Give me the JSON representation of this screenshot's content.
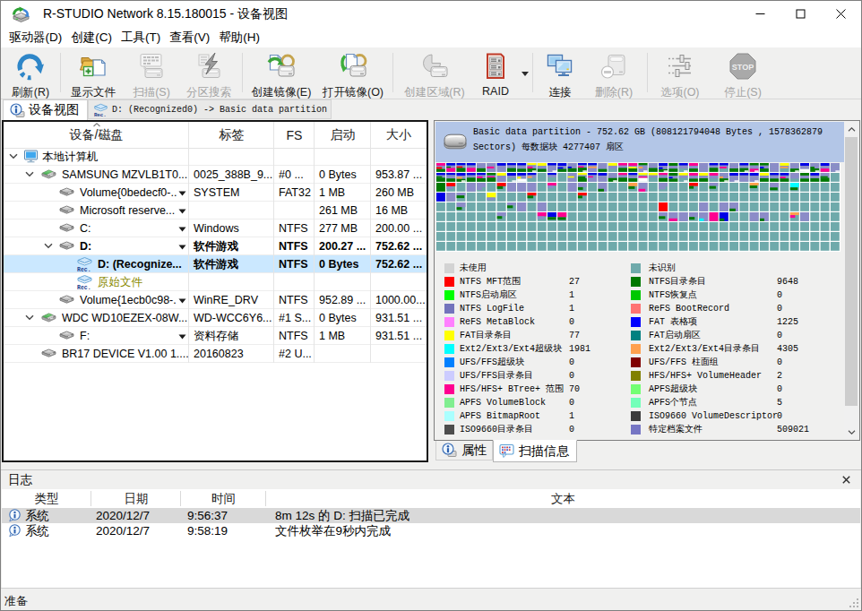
{
  "window": {
    "title": "R-STUDIO Network 8.15.180015 - 设备视图"
  },
  "menu": {
    "items": [
      {
        "id": "drive",
        "label": "驱动器(D)"
      },
      {
        "id": "create",
        "label": "创建(C)"
      },
      {
        "id": "tools",
        "label": "工具(T)"
      },
      {
        "id": "view",
        "label": "查看(V)"
      },
      {
        "id": "help",
        "label": "帮助(H)"
      }
    ]
  },
  "toolbar": {
    "buttons": [
      {
        "id": "refresh",
        "icon": "refresh-icon",
        "label": "刷新(R)",
        "enabled": true
      },
      {
        "id": "show-files",
        "icon": "show-files-icon",
        "label": "显示文件",
        "enabled": true
      },
      {
        "id": "scan",
        "icon": "scan-icon",
        "label": "扫描(S)",
        "enabled": false
      },
      {
        "id": "partition-search",
        "icon": "partition-search-icon",
        "label": "分区搜索",
        "enabled": false
      },
      {
        "id": "create-image",
        "icon": "create-image-icon",
        "label": "创建镜像(E)",
        "enabled": true
      },
      {
        "id": "open-image",
        "icon": "open-image-icon",
        "label": "打开镜像(O)",
        "enabled": true
      },
      {
        "id": "create-region",
        "icon": "create-region-icon",
        "label": "创建区域(R)",
        "enabled": false
      },
      {
        "id": "raid",
        "icon": "raid-icon",
        "label": "RAID",
        "enabled": true,
        "dropdown": true
      },
      {
        "id": "connect",
        "icon": "connect-icon",
        "label": "连接",
        "enabled": true
      },
      {
        "id": "delete",
        "icon": "delete-icon",
        "label": "删除(R)",
        "enabled": false
      },
      {
        "id": "options",
        "icon": "options-icon",
        "label": "选项(O)",
        "enabled": false
      },
      {
        "id": "stop",
        "icon": "stop-icon",
        "label": "停止(S)",
        "enabled": false
      }
    ]
  },
  "view_tabs": [
    {
      "id": "device-view",
      "icon": "info-disk-icon",
      "label": "设备视图",
      "active": true
    },
    {
      "id": "recognized",
      "icon": "rec-icon",
      "label": "D: (Recognized0) -> Basic data partition",
      "active": false
    }
  ],
  "tree": {
    "columns": [
      {
        "label": "设备/磁盘",
        "sorted": true
      },
      {
        "label": "标签"
      },
      {
        "label": "FS"
      },
      {
        "label": "启动"
      },
      {
        "label": "大小"
      }
    ],
    "rows": [
      {
        "name": "本地计算机",
        "level": 0,
        "icon": "computer",
        "chevron": true,
        "label": "",
        "fs": "",
        "start": "",
        "size": ""
      },
      {
        "name": "SAMSUNG MZVLB1T0...",
        "level": 1,
        "icon": "disk-green",
        "chevron": true,
        "label": "0025_388B_9...",
        "fs": "#0 ...",
        "start": "0 Bytes",
        "size": "953.87 ..."
      },
      {
        "name": "Volume{0bedecf0-...",
        "level": 2,
        "icon": "volume",
        "dropdown": true,
        "label": "SYSTEM",
        "fs": "FAT32",
        "start": "1 MB",
        "size": "260 MB"
      },
      {
        "name": "Microsoft reserve...",
        "level": 2,
        "icon": "volume",
        "dropdown": true,
        "label": "",
        "fs": "",
        "start": "261 MB",
        "size": "16 MB"
      },
      {
        "name": "C:",
        "level": 2,
        "icon": "volume",
        "dropdown": true,
        "label": "Windows",
        "fs": "NTFS",
        "start": "277 MB",
        "size": "200.00 ..."
      },
      {
        "name": "D:",
        "level": 2,
        "icon": "volume",
        "chevron": true,
        "dropdown": true,
        "bold": true,
        "label": "软件游戏",
        "fs": "NTFS",
        "start": "200.27 ...",
        "size": "752.62 ..."
      },
      {
        "name": "D: (Recognize...",
        "level": 3,
        "icon": "rec",
        "bold": true,
        "selected": true,
        "label": "软件游戏",
        "fs": "NTFS",
        "start": "0 Bytes",
        "size": "752.62 ..."
      },
      {
        "name": "原始文件",
        "level": 3,
        "icon": "rec",
        "olive": true,
        "label": "",
        "fs": "",
        "start": "",
        "size": ""
      },
      {
        "name": "Volume{1ecb0c98-...",
        "level": 2,
        "icon": "volume",
        "dropdown": true,
        "label": "WinRE_DRV",
        "fs": "NTFS",
        "start": "952.89 ...",
        "size": "1000.00..."
      },
      {
        "name": "WDC WD10EZEX-08W...",
        "level": 1,
        "icon": "disk-green",
        "chevron": true,
        "label": "WD-WCC6Y6...",
        "fs": "#1 S...",
        "start": "0 Bytes",
        "size": "931.51 ..."
      },
      {
        "name": "F:",
        "level": 2,
        "icon": "volume",
        "dropdown": true,
        "label": "资料存储",
        "fs": "NTFS",
        "start": "1 MB",
        "size": "931.51 ..."
      },
      {
        "name": "BR17 DEVICE V1.00 1....",
        "level": 1,
        "icon": "volume",
        "label": "20160823",
        "fs": "#2 U...",
        "start": "",
        "size": ""
      }
    ]
  },
  "scan": {
    "header_text": "Basic data partition - 752.62 GB (808121794048 Bytes , 1578362879\nSectors) 每数据块 4277407 扇区",
    "legend_left": [
      {
        "label": "未使用",
        "color": "#d3d3d3",
        "count": ""
      },
      {
        "label": "NTFS MFT范围",
        "color": "#ff0000",
        "count": "27"
      },
      {
        "label": "NTFS启动扇区",
        "color": "#00ff00",
        "count": "1"
      },
      {
        "label": "NTFS LogFile",
        "color": "#7373bc",
        "count": "1"
      },
      {
        "label": "ReFS MetaBlock",
        "color": "#ff80ff",
        "count": "0"
      },
      {
        "label": "FAT目录条目",
        "color": "#ffff00",
        "count": "77"
      },
      {
        "label": "Ext2/Ext3/Ext4超级块",
        "color": "#00ffff",
        "count": "1981"
      },
      {
        "label": "UFS/FFS超级块",
        "color": "#0080ff",
        "count": "0"
      },
      {
        "label": "UFS/FFS目录条目",
        "color": "#ccccff",
        "count": "0"
      },
      {
        "label": "HFS/HFS+ BTree+ 范围",
        "color": "#ff0090",
        "count": "70"
      },
      {
        "label": "APFS VolumeBlock",
        "color": "#80ee90",
        "count": "0"
      },
      {
        "label": "APFS BitmapRoot",
        "color": "#aaffff",
        "count": "1"
      },
      {
        "label": "ISO9660目录条目",
        "color": "#4d4d4d",
        "count": "0"
      }
    ],
    "legend_right": [
      {
        "label": "未识别",
        "color": "#6faaab",
        "count": ""
      },
      {
        "label": "NTFS目录条目",
        "color": "#007800",
        "count": "9648"
      },
      {
        "label": "NTFS恢复点",
        "color": "#00c800",
        "count": "0"
      },
      {
        "label": "ReFS BootRecord",
        "color": "#ff7373",
        "count": "0"
      },
      {
        "label": "FAT 表格项",
        "color": "#0000ff",
        "count": "1225"
      },
      {
        "label": "FAT启动扇区",
        "color": "#008080",
        "count": "0"
      },
      {
        "label": "Ext2/Ext3/Ext4目录条目",
        "color": "#ffa04d",
        "count": "4305"
      },
      {
        "label": "UFS/FFS 柱面组",
        "color": "#800000",
        "count": "0"
      },
      {
        "label": "HFS/HFS+ VolumeHeader",
        "color": "#808000",
        "count": "2"
      },
      {
        "label": "APFS超级块",
        "color": "#73ff73",
        "count": "0"
      },
      {
        "label": "APFS个节点",
        "color": "#73ffb9",
        "count": "5"
      },
      {
        "label": "ISO9660 VolumeDescriptor",
        "color": "#3c3c3c",
        "count": "0"
      },
      {
        "label": "特定档案文件",
        "color": "#7676c4",
        "count": "509021"
      }
    ],
    "blockmap": {
      "cols": 40,
      "rows": 9,
      "seed": 12,
      "base": "#6faaab",
      "stripe_colors": [
        "#8c8cc8",
        "#007800",
        "#0000e6",
        "#ffff00",
        "#ff0090",
        "#ffa04d",
        "#00ffff",
        "#ff0000",
        "#00c800",
        "#808000",
        "#aaffff",
        "#d3d3d3"
      ]
    }
  },
  "bottom_tabs": [
    {
      "id": "properties",
      "icon": "info-disk-icon",
      "label": "属性",
      "active": false
    },
    {
      "id": "scan-info",
      "icon": "scan-info-icon",
      "label": "扫描信息",
      "active": true
    }
  ],
  "log": {
    "title": "日志",
    "columns": [
      "类型",
      "日期",
      "时间",
      "文本"
    ],
    "rows": [
      {
        "type": "系统",
        "date": "2020/12/7",
        "time": "9:56:37",
        "text": "8m 12s 的 D: 扫描已完成",
        "highlight": true
      },
      {
        "type": "系统",
        "date": "2020/12/7",
        "time": "9:58:19",
        "text": "文件枚举在9秒内完成",
        "highlight": false
      }
    ]
  },
  "statusbar": {
    "text": "准备"
  }
}
